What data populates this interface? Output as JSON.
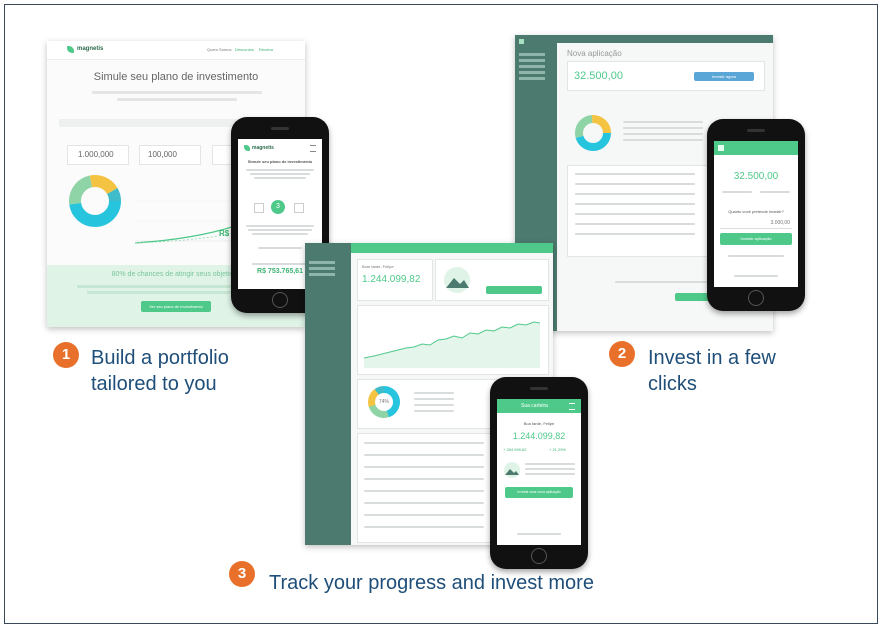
{
  "steps": [
    {
      "number": "1",
      "line1": "Build a portfolio",
      "line2": "tailored to you"
    },
    {
      "number": "2",
      "line1": "Invest in a few",
      "line2": "clicks"
    },
    {
      "number": "3",
      "line1": "Track your progress and invest more",
      "line2": ""
    }
  ],
  "shot1": {
    "brand": "magnetis",
    "nav": [
      "Quem Somos",
      "Descontos",
      "Receba"
    ],
    "title": "Simule seu plano de investimento",
    "fields": [
      "1.000,000",
      "100,000",
      "0"
    ],
    "result": "R$ 876.371",
    "chance": "80% de chances de atingir seus objetivos",
    "cta": "Ver seu plano de investimento"
  },
  "phone1": {
    "brand": "magnetis",
    "title": "Simule seu plano de investimento",
    "step": "3",
    "amount": "R$ 753.765,61"
  },
  "shot2": {
    "title": "Nova aplicação",
    "amount": "32.500,00",
    "button": "Investir agora"
  },
  "phone2": {
    "amount": "32.500,00",
    "question": "Quanto você pretende investir?",
    "value": "3.000,00",
    "button": "Investir aplicação"
  },
  "shot3": {
    "greeting": "Bom tarde, Felipe",
    "total": "1.244.099,82",
    "percent": "74%"
  },
  "phone3": {
    "header": "Sua carteira",
    "greeting": "Boa tarde, Felipe",
    "total": "1.244.099,82",
    "gain1": "+ 264.999,62",
    "gain2": "+ 21,29%",
    "button": "Investir uma nova aplicação"
  },
  "colors": {
    "accent": "#4fc98a",
    "sidebar": "#4d7a6e",
    "caption": "#1f4e79",
    "badge": "#e8702a"
  }
}
